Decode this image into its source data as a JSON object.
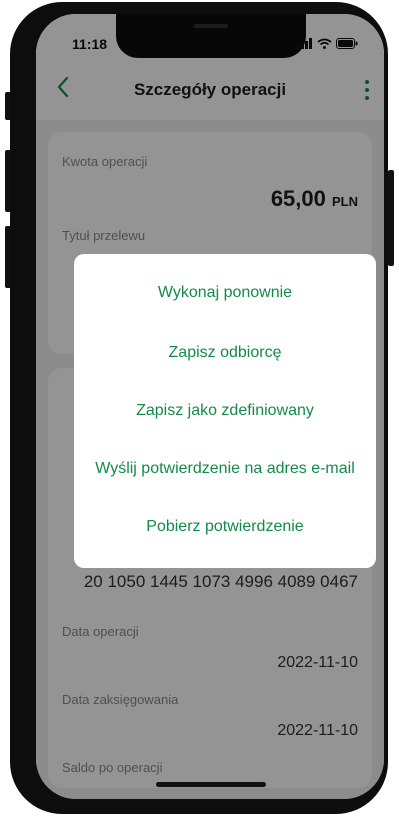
{
  "status_bar": {
    "time": "11:18"
  },
  "header": {
    "title": "Szczegóły operacji"
  },
  "details": {
    "amount_label": "Kwota operacji",
    "amount_value": "65,00",
    "amount_currency": "PLN",
    "title_label": "Tytuł przelewu",
    "account_number": "20 1050 1445 1073 4996 4089 0467",
    "date_label": "Data operacji",
    "date_value": "2022-11-10",
    "booking_label": "Data zaksięgowania",
    "booking_value": "2022-11-10",
    "balance_label": "Saldo po operacji"
  },
  "menu": {
    "items": [
      {
        "label": "Wykonaj ponownie"
      },
      {
        "label": "Zapisz odbiorcę"
      },
      {
        "label": "Zapisz jako zdefiniowany"
      },
      {
        "label": "Wyślij potwierdzenie na adres e-mail"
      },
      {
        "label": "Pobierz potwierdzenie"
      }
    ]
  },
  "colors": {
    "accent": "#138a49",
    "frame": "#0d0d0d"
  },
  "icons": [
    "back-arrow-icon",
    "more-vertical-icon",
    "signal-icon",
    "wifi-icon",
    "battery-icon"
  ]
}
